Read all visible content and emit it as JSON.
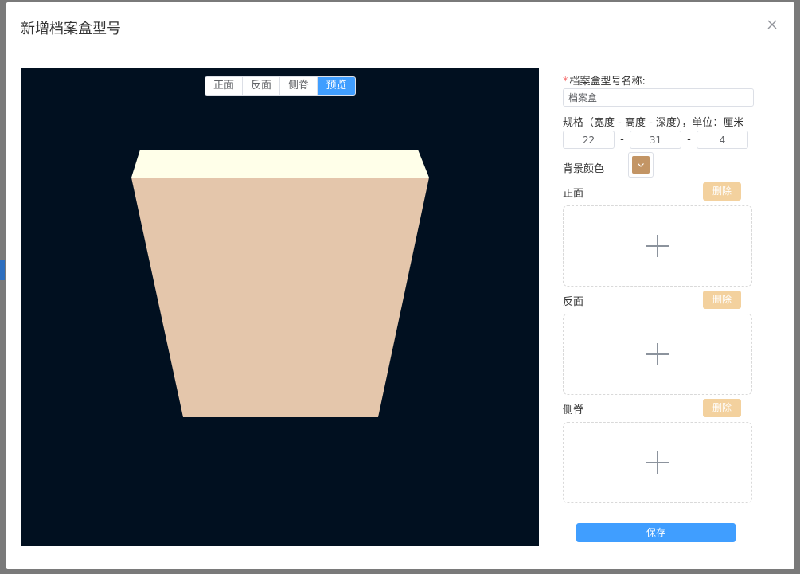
{
  "dialog": {
    "title": "新增档案盒型号"
  },
  "viewer": {
    "tabs": [
      {
        "label": "正面"
      },
      {
        "label": "反面"
      },
      {
        "label": "侧脊"
      },
      {
        "label": "预览"
      }
    ],
    "active_tab": "预览",
    "background_color": "#011020",
    "box_top_color": "#ffffe9",
    "box_front_color": "#e4c6ab"
  },
  "form": {
    "name_label": "档案盒型号名称:",
    "name_value": "档案盒",
    "spec_label": "规格（宽度 - 高度 - 深度），单位：厘米",
    "spec": {
      "width": "22",
      "height": "31",
      "depth": "4"
    },
    "spec_sep": "-",
    "color_label": "背景颜色",
    "color_value": "#c39565",
    "front_label": "正面",
    "back_label": "反面",
    "spine_label": "侧脊",
    "delete_label": "删除",
    "save_label": "保存"
  },
  "colors": {
    "primary": "#409eff",
    "warning_disabled": "#f3d19e",
    "required": "#f56c6c"
  }
}
